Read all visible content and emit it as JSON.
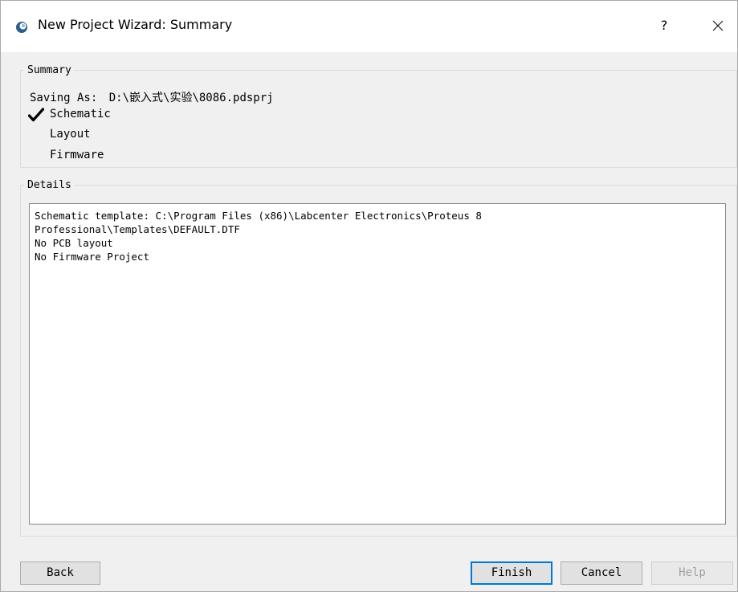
{
  "window": {
    "title": "New Project Wizard: Summary",
    "help_glyph": "?"
  },
  "summary": {
    "legend": "Summary",
    "saving_as_label": "Saving As:",
    "saving_as_path": "D:\\嵌入式\\实验\\8086.pdsprj",
    "items": [
      {
        "label": "Schematic",
        "checked": true
      },
      {
        "label": "Layout",
        "checked": false
      },
      {
        "label": "Firmware",
        "checked": false
      }
    ]
  },
  "details": {
    "legend": "Details",
    "lines": [
      "Schematic template: C:\\Program Files (x86)\\Labcenter Electronics\\Proteus 8",
      "Professional\\Templates\\DEFAULT.DTF",
      "No PCB layout",
      "No Firmware Project"
    ]
  },
  "buttons": {
    "back": "Back",
    "finish": "Finish",
    "cancel": "Cancel",
    "help": "Help"
  },
  "colors": {
    "accent": "#0078d7",
    "disabled_text": "#a0a0a0"
  }
}
